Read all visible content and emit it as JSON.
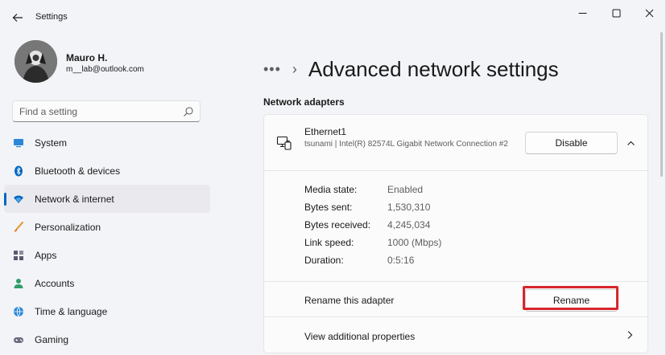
{
  "window": {
    "title": "Settings"
  },
  "profile": {
    "name": "Mauro H.",
    "email": "m__lab@outlook.com"
  },
  "search": {
    "placeholder": "Find a setting"
  },
  "sidebar": {
    "items": [
      {
        "label": "System",
        "icon": "system-icon"
      },
      {
        "label": "Bluetooth & devices",
        "icon": "bluetooth-icon"
      },
      {
        "label": "Network & internet",
        "icon": "wifi-icon",
        "active": true
      },
      {
        "label": "Personalization",
        "icon": "brush-icon"
      },
      {
        "label": "Apps",
        "icon": "apps-icon"
      },
      {
        "label": "Accounts",
        "icon": "accounts-icon"
      },
      {
        "label": "Time & language",
        "icon": "globe-icon"
      },
      {
        "label": "Gaming",
        "icon": "gaming-icon"
      }
    ]
  },
  "breadcrumb": {
    "more": "•••",
    "separator": "›",
    "title": "Advanced network settings"
  },
  "main": {
    "section_title": "Network adapters",
    "adapter": {
      "name": "Ethernet1",
      "description": "tsunami | Intel(R) 82574L Gigabit Network Connection #2",
      "disable_label": "Disable",
      "properties": [
        {
          "key": "Media state:",
          "value": "Enabled"
        },
        {
          "key": "Bytes sent:",
          "value": "1,530,310"
        },
        {
          "key": "Bytes received:",
          "value": "4,245,034"
        },
        {
          "key": "Link speed:",
          "value": "1000 (Mbps)"
        },
        {
          "key": "Duration:",
          "value": "0:5:16"
        }
      ],
      "rename_label": "Rename this adapter",
      "rename_button": "Rename",
      "more_label": "View additional properties"
    }
  },
  "colors": {
    "accent": "#0067c0",
    "highlight": "#d8262c"
  }
}
